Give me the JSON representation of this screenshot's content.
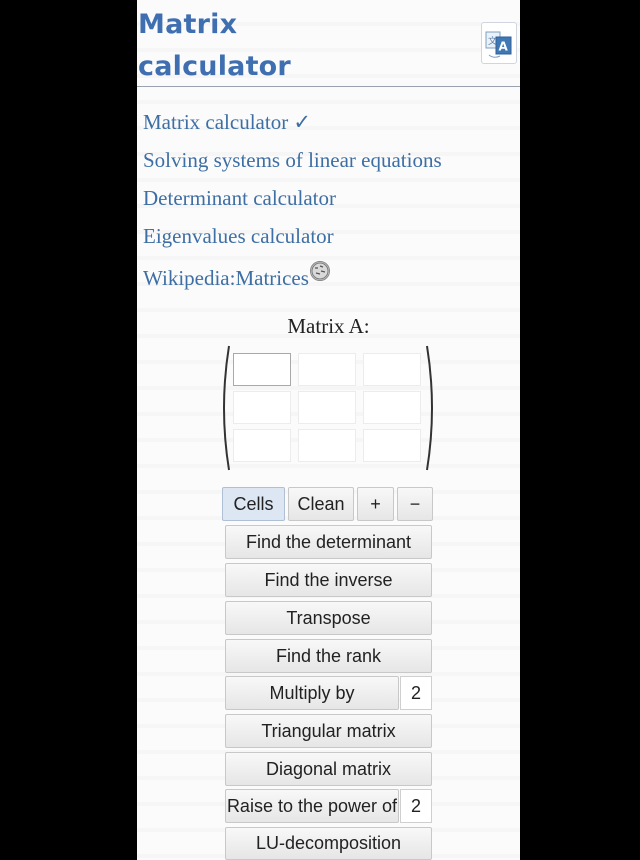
{
  "header": {
    "title_line1": "Matrix",
    "title_line2": "calculator"
  },
  "nav": [
    {
      "label": "Matrix calculator ✓"
    },
    {
      "label": "Solving systems of linear equations"
    },
    {
      "label": "Determinant calculator"
    },
    {
      "label": "Eigenvalues calculator"
    },
    {
      "label": "Wikipedia:Matrices"
    }
  ],
  "matrix": {
    "label": "Matrix A:",
    "rows": 3,
    "cols": 3,
    "values": [
      "",
      "",
      "",
      "",
      "",
      "",
      "",
      "",
      ""
    ]
  },
  "controls": {
    "cells": "Cells",
    "clean": "Clean",
    "plus": "+",
    "minus": "−"
  },
  "operations": {
    "determinant": "Find the determinant",
    "inverse": "Find the inverse",
    "transpose": "Transpose",
    "rank": "Find the rank",
    "multiply": "Multiply by",
    "multiply_value": "2",
    "triangular": "Triangular matrix",
    "diagonal": "Diagonal matrix",
    "power": "Raise to the power of",
    "power_value": "2",
    "lu": "LU-decomposition"
  },
  "icons": {
    "language": "translate-icon",
    "wiki": "wikipedia-globe-icon"
  }
}
